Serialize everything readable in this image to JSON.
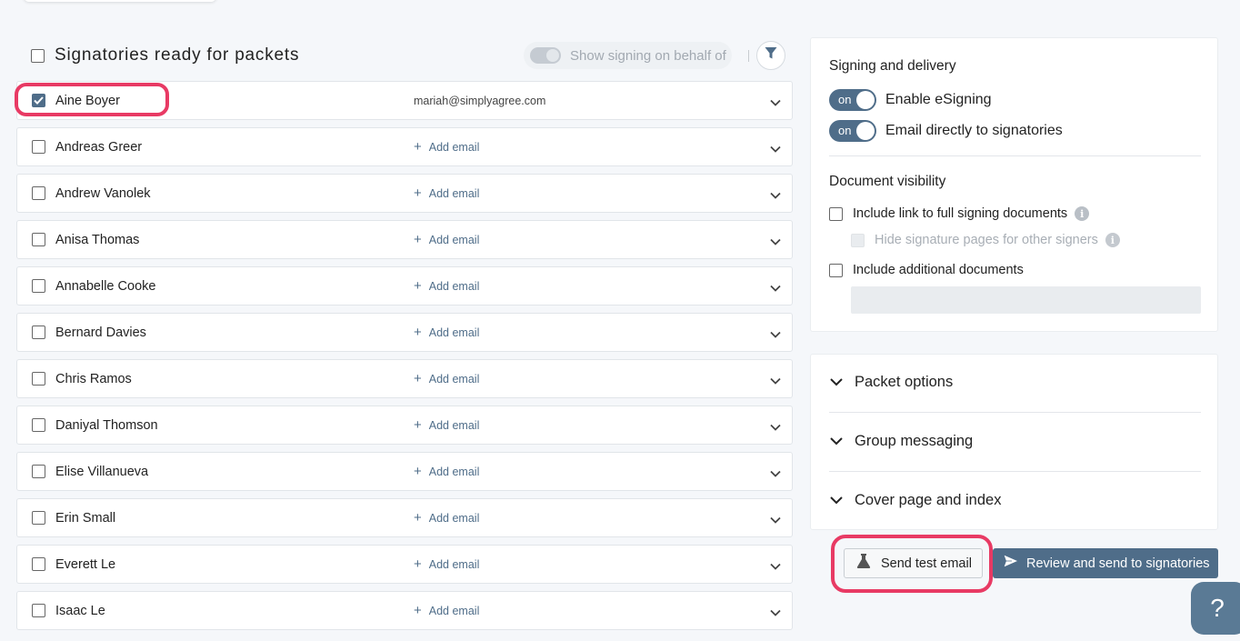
{
  "list": {
    "title": "Signatories ready for packets",
    "behalf_toggle_label": "Show signing on behalf of",
    "add_email_label": "Add email",
    "rows": [
      {
        "name": "Aine Boyer",
        "email": "mariah@simplyagree.com",
        "checked": true
      },
      {
        "name": "Andreas Greer",
        "email": "",
        "checked": false
      },
      {
        "name": "Andrew Vanolek",
        "email": "",
        "checked": false
      },
      {
        "name": "Anisa Thomas",
        "email": "",
        "checked": false
      },
      {
        "name": "Annabelle Cooke",
        "email": "",
        "checked": false
      },
      {
        "name": "Bernard Davies",
        "email": "",
        "checked": false
      },
      {
        "name": "Chris Ramos",
        "email": "",
        "checked": false
      },
      {
        "name": "Daniyal Thomson",
        "email": "",
        "checked": false
      },
      {
        "name": "Elise Villanueva",
        "email": "",
        "checked": false
      },
      {
        "name": "Erin Small",
        "email": "",
        "checked": false
      },
      {
        "name": "Everett Le",
        "email": "",
        "checked": false
      },
      {
        "name": "Isaac Le",
        "email": "",
        "checked": false
      }
    ]
  },
  "signing": {
    "title": "Signing and delivery",
    "toggle_on_text": "on",
    "esigning_label": "Enable eSigning",
    "email_direct_label": "Email directly to signatories"
  },
  "visibility": {
    "title": "Document visibility",
    "include_link_label": "Include link to full signing documents",
    "hide_pages_label": "Hide signature pages for other signers",
    "include_additional_label": "Include additional documents"
  },
  "accordions": {
    "packet_options": "Packet options",
    "group_messaging": "Group messaging",
    "cover_page": "Cover page and index"
  },
  "actions": {
    "send_test_label": "Send test email",
    "review_send_label": "Review and send to signatories",
    "help_label": "?"
  },
  "colors": {
    "accent": "#4f6d89",
    "highlight": "#e83a64"
  }
}
